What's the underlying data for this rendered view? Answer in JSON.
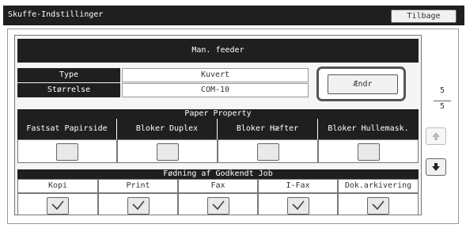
{
  "header": {
    "title": "Skuffe-Indstillinger",
    "back_label": "Tilbage"
  },
  "feeder": {
    "title": "Man. feeder"
  },
  "settings": {
    "type_label": "Type",
    "type_value": "Kuvert",
    "size_label": "Størrelse",
    "size_value": "COM-10",
    "change_label": "Ændr"
  },
  "paper_property": {
    "title": "Paper Property",
    "columns": [
      "Fastsat Papirside",
      "Bloker Duplex",
      "Bloker Hæfter",
      "Bloker Hullemask."
    ],
    "checked": [
      false,
      false,
      false,
      false
    ]
  },
  "approved_job": {
    "title": "Fødning af Godkendt Job",
    "columns": [
      "Kopi",
      "Print",
      "Fax",
      "I-Fax",
      "Dok.arkivering"
    ],
    "checked": [
      true,
      true,
      true,
      true,
      true
    ]
  },
  "pager": {
    "current": "5",
    "total": "5"
  },
  "icons": {
    "up": "arrow-up-icon",
    "down": "arrow-down-icon",
    "check": "checkmark-icon"
  }
}
